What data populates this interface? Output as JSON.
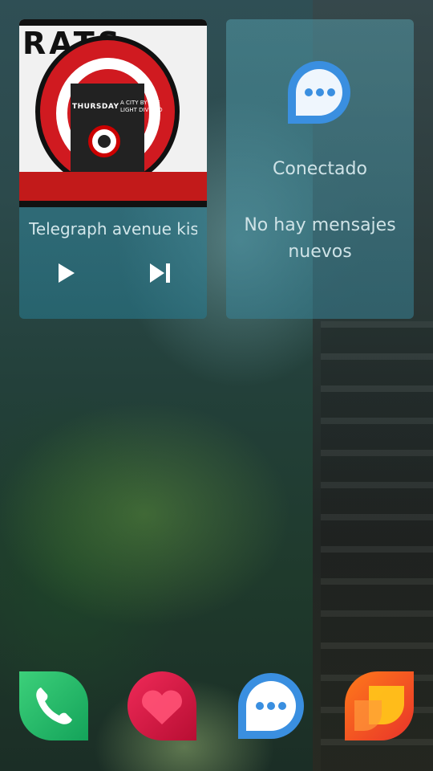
{
  "music": {
    "album_band": "THURSDAY",
    "album_title": "A CITY BY THE LIGHT DIVIDED",
    "album_scrawl": "RATS",
    "track_title": "Telegraph avenue kiss"
  },
  "messages": {
    "status": "Conectado",
    "empty_text": "No hay mensajes nuevos"
  },
  "dock": {
    "icons": [
      "phone-icon",
      "people-icon",
      "messages-icon",
      "store-icon"
    ]
  },
  "colors": {
    "phone": "#2bbf6b",
    "people": "#e01a4f",
    "messages": "#3a8fe0",
    "store": "#f5a30a"
  }
}
